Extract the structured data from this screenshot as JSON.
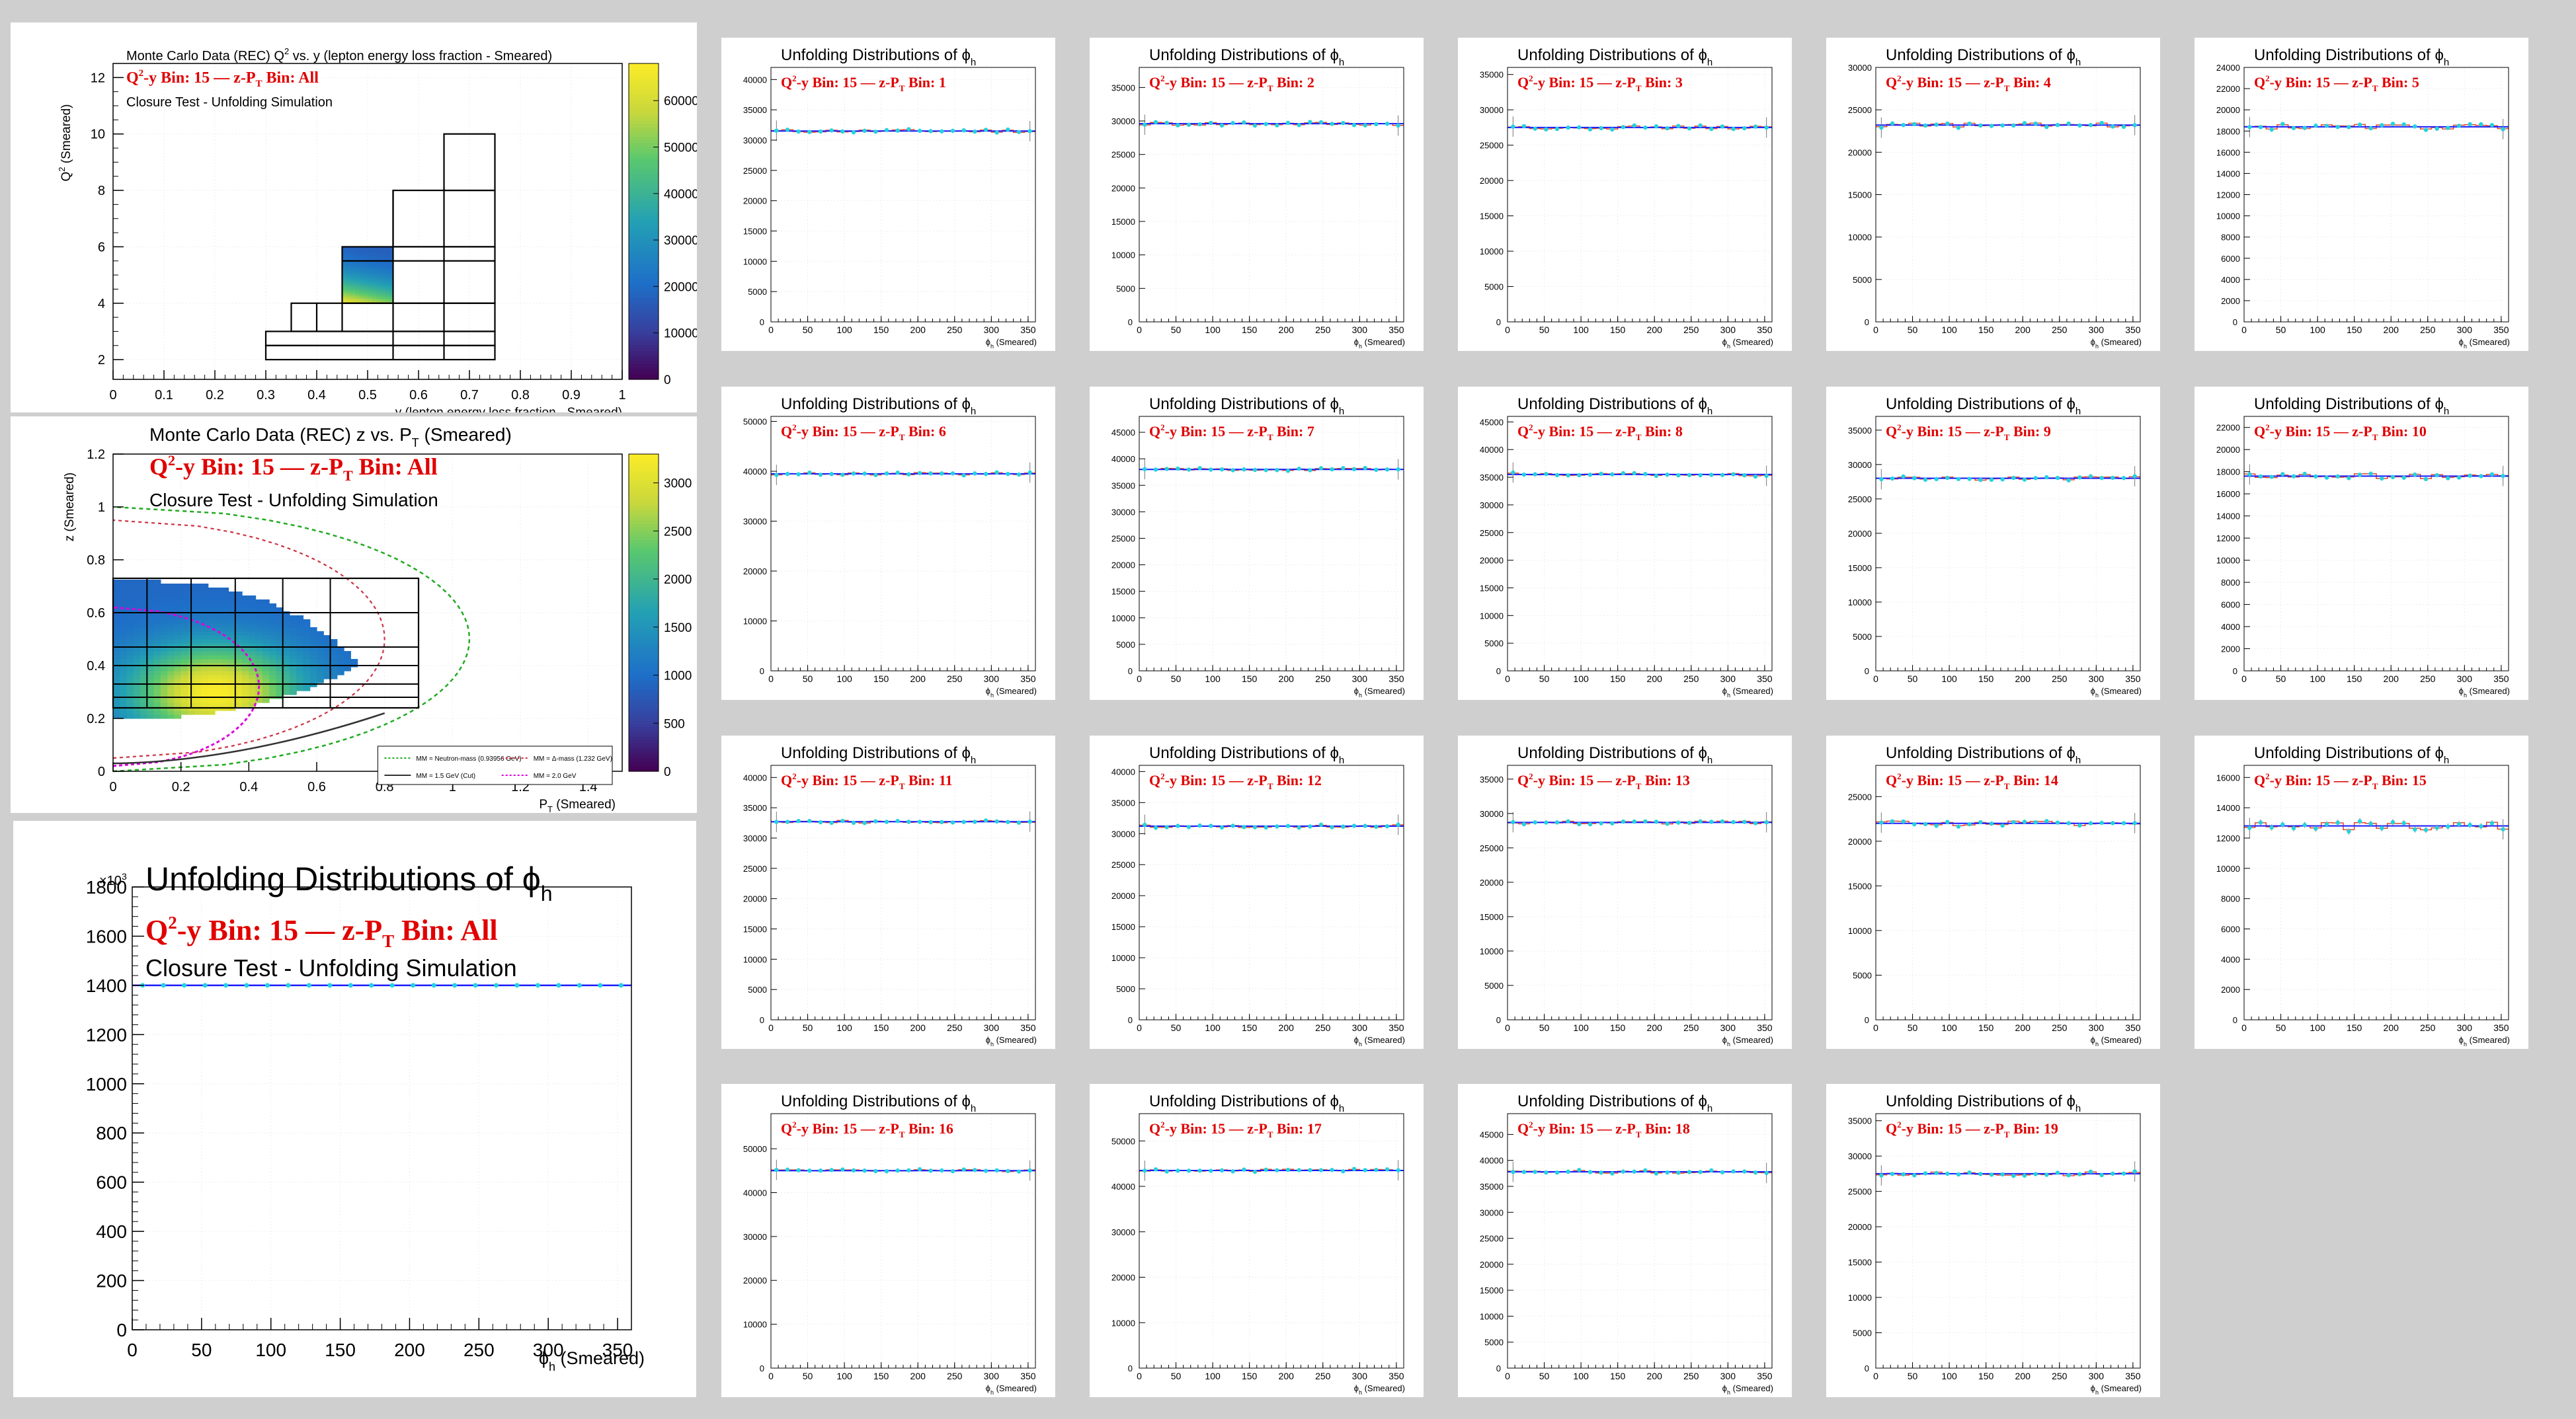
{
  "colors": {
    "background": "#cfcfcf",
    "panel": "#ffffff",
    "red_text": "#e00000",
    "fit_line": "#1a1aff",
    "hist_line": "#e04a2a",
    "points": "#22d3e0",
    "grid": "#eeeeee"
  },
  "palette_name": "viridis-like (blue to yellow)",
  "main_title": "Unfolding Distributions of",
  "phi_symbol": "ϕ",
  "phi_subscript": "h",
  "q2y_label": "Q",
  "q2y_sup": "2",
  "q2y_rest": "-y Bin: 15",
  "dash": "—",
  "zpt_label": "z-P",
  "zpt_sub": "T",
  "zpt_all": " Bin: All",
  "closure": "Closure Test - Unfolding Simulation",
  "chart_data": [
    {
      "id": "q2y",
      "type": "heatmap",
      "title": "Monte Carlo Data (REC) Q  vs. y (lepton energy loss fraction - Smeared)",
      "title_sup": "2",
      "xlabel": "y (lepton energy loss fraction - Smeared)",
      "ylabel": "Q  (Smeared)",
      "ylabel_sup": "2",
      "xlim": [
        0,
        1
      ],
      "ylim": [
        1.3,
        12.5
      ],
      "xticks": [
        "0",
        "0.1",
        "0.2",
        "0.3",
        "0.4",
        "0.5",
        "0.6",
        "0.7",
        "0.8",
        "0.9",
        "1"
      ],
      "yticks": [
        "2",
        "4",
        "6",
        "8",
        "10",
        "12"
      ],
      "zticks": [
        "0",
        "10000",
        "20000",
        "30000",
        "40000",
        "50000",
        "60000"
      ],
      "zlim": [
        0,
        68000
      ],
      "filled_region": {
        "x": [
          0.45,
          0.55
        ],
        "y": [
          4.0,
          6.0
        ]
      },
      "bin_grid": [
        [
          0.3,
          2.0,
          0.75,
          2.5
        ],
        [
          0.3,
          2.5,
          0.75,
          3.0
        ],
        [
          0.35,
          3.0,
          0.75,
          4.0
        ],
        [
          0.45,
          4.0,
          0.75,
          6.0
        ],
        [
          0.55,
          6.0,
          0.75,
          8.0
        ],
        [
          0.65,
          8.0,
          0.75,
          10.0
        ]
      ],
      "bin_lines": [
        [
          0.4,
          3.0,
          0.4,
          4.0
        ],
        [
          0.45,
          3.0,
          0.45,
          4.0
        ],
        [
          0.55,
          2.0,
          0.55,
          8.0
        ],
        [
          0.65,
          2.0,
          0.65,
          8.0
        ],
        [
          0.45,
          5.5,
          0.75,
          5.5
        ],
        [
          0.45,
          4.0,
          0.55,
          4.0
        ]
      ]
    },
    {
      "id": "zpt",
      "type": "heatmap",
      "title": "Monte Carlo Data (REC) z vs. P",
      "title_sub": "T",
      "title_end": " (Smeared)",
      "xlabel": "P",
      "xlabel_sub": "T",
      "xlabel_end": " (Smeared)",
      "ylabel": "z (Smeared)",
      "xlim": [
        0,
        1.5
      ],
      "ylim": [
        0,
        1.2
      ],
      "xticks": [
        "0",
        "0.2",
        "0.4",
        "0.6",
        "0.8",
        "1",
        "1.2",
        "1.4"
      ],
      "yticks": [
        "0",
        "0.2",
        "0.4",
        "0.6",
        "0.8",
        "1",
        "1.2"
      ],
      "zticks": [
        "0",
        "500",
        "1000",
        "1500",
        "2000",
        "2500",
        "3000"
      ],
      "zlim": [
        0,
        3300
      ],
      "bin_rect": [
        0,
        0.24,
        0.9,
        0.73
      ],
      "bin_x_edges": [
        0.1,
        0.23,
        0.36,
        0.5,
        0.64,
        0.9
      ],
      "bin_y_edges": [
        0.28,
        0.33,
        0.4,
        0.47,
        0.6
      ],
      "legend": [
        {
          "label": "MM = Neutron-mass (0.93956 GeV)",
          "color": "#22aa22",
          "dash": "3,3"
        },
        {
          "label": "MM = Δ-mass (1.232 GeV)",
          "color": "#cc3344",
          "dash": "3,3"
        },
        {
          "label": "MM = 1.5 GeV (Cut)",
          "color": "#333333",
          "dash": ""
        },
        {
          "label": "MM = 2.0 GeV",
          "color": "#dd00dd",
          "dash": "3,3"
        }
      ]
    },
    {
      "id": "big_all",
      "type": "line",
      "xlabel": "ϕ",
      "xlabel_sub": "h",
      "xlabel_end": " (Smeared)",
      "exponent": "×10",
      "exponent_sup": "3",
      "xlim": [
        0,
        360
      ],
      "ylim": [
        0,
        1800
      ],
      "xticks": [
        "0",
        "50",
        "100",
        "150",
        "200",
        "250",
        "300",
        "350"
      ],
      "yticks": [
        "0",
        "200",
        "400",
        "600",
        "800",
        "1000",
        "1200",
        "1400",
        "1600",
        "1800"
      ],
      "level": 1400
    }
  ],
  "small_panels": {
    "xlabel": "ϕ",
    "xlabel_sub": "h",
    "xlabel_end": " (Smeared)",
    "xticks": [
      "0",
      "50",
      "100",
      "150",
      "200",
      "250",
      "300",
      "350"
    ],
    "items": [
      {
        "bin": "1",
        "level": 31500,
        "ylim": [
          0,
          42000
        ],
        "yticks": [
          "5000",
          "10000",
          "15000",
          "20000",
          "25000",
          "30000",
          "35000",
          "40000"
        ],
        "noise": 0.008
      },
      {
        "bin": "2",
        "level": 29600,
        "ylim": [
          0,
          38000
        ],
        "yticks": [
          "5000",
          "10000",
          "15000",
          "20000",
          "25000",
          "30000",
          "35000"
        ],
        "noise": 0.009
      },
      {
        "bin": "3",
        "level": 27500,
        "ylim": [
          0,
          36000
        ],
        "yticks": [
          "5000",
          "10000",
          "15000",
          "20000",
          "25000",
          "30000",
          "35000"
        ],
        "noise": 0.008
      },
      {
        "bin": "4",
        "level": 23200,
        "ylim": [
          0,
          30000
        ],
        "yticks": [
          "5000",
          "10000",
          "15000",
          "20000",
          "25000",
          "30000"
        ],
        "noise": 0.01
      },
      {
        "bin": "5",
        "level": 18400,
        "ylim": [
          0,
          24000
        ],
        "yticks": [
          "2000",
          "4000",
          "6000",
          "8000",
          "10000",
          "12000",
          "14000",
          "16000",
          "18000",
          "20000",
          "22000",
          "24000"
        ],
        "noise": 0.012
      },
      {
        "bin": "6",
        "level": 39500,
        "ylim": [
          0,
          51000
        ],
        "yticks": [
          "10000",
          "20000",
          "30000",
          "40000",
          "50000"
        ],
        "noise": 0.006
      },
      {
        "bin": "7",
        "level": 38000,
        "ylim": [
          0,
          48000
        ],
        "yticks": [
          "5000",
          "10000",
          "15000",
          "20000",
          "25000",
          "30000",
          "35000",
          "40000",
          "45000"
        ],
        "noise": 0.006
      },
      {
        "bin": "8",
        "level": 35500,
        "ylim": [
          0,
          46000
        ],
        "yticks": [
          "5000",
          "10000",
          "15000",
          "20000",
          "25000",
          "30000",
          "35000",
          "40000",
          "45000"
        ],
        "noise": 0.007
      },
      {
        "bin": "9",
        "level": 28000,
        "ylim": [
          0,
          37000
        ],
        "yticks": [
          "5000",
          "10000",
          "15000",
          "20000",
          "25000",
          "30000",
          "35000"
        ],
        "noise": 0.01
      },
      {
        "bin": "10",
        "level": 17600,
        "ylim": [
          0,
          23000
        ],
        "yticks": [
          "2000",
          "4000",
          "6000",
          "8000",
          "10000",
          "12000",
          "14000",
          "16000",
          "18000",
          "20000",
          "22000"
        ],
        "noise": 0.013
      },
      {
        "bin": "11",
        "level": 32700,
        "ylim": [
          0,
          42000
        ],
        "yticks": [
          "5000",
          "10000",
          "15000",
          "20000",
          "25000",
          "30000",
          "35000",
          "40000"
        ],
        "noise": 0.007
      },
      {
        "bin": "12",
        "level": 31200,
        "ylim": [
          0,
          41000
        ],
        "yticks": [
          "5000",
          "10000",
          "15000",
          "20000",
          "25000",
          "30000",
          "35000",
          "40000"
        ],
        "noise": 0.007
      },
      {
        "bin": "13",
        "level": 28700,
        "ylim": [
          0,
          37000
        ],
        "yticks": [
          "5000",
          "10000",
          "15000",
          "20000",
          "25000",
          "30000",
          "35000"
        ],
        "noise": 0.008
      },
      {
        "bin": "14",
        "level": 22000,
        "ylim": [
          0,
          28500
        ],
        "yticks": [
          "5000",
          "10000",
          "15000",
          "20000",
          "25000"
        ],
        "noise": 0.012
      },
      {
        "bin": "15",
        "level": 12800,
        "ylim": [
          0,
          16800
        ],
        "yticks": [
          "2000",
          "4000",
          "6000",
          "8000",
          "10000",
          "12000",
          "14000",
          "16000"
        ],
        "noise": 0.02
      },
      {
        "bin": "16",
        "level": 45000,
        "ylim": [
          0,
          58000
        ],
        "yticks": [
          "10000",
          "20000",
          "30000",
          "40000",
          "50000"
        ],
        "noise": 0.006
      },
      {
        "bin": "17",
        "level": 43500,
        "ylim": [
          0,
          56000
        ],
        "yticks": [
          "10000",
          "20000",
          "30000",
          "40000",
          "50000"
        ],
        "noise": 0.006
      },
      {
        "bin": "18",
        "level": 37800,
        "ylim": [
          0,
          49000
        ],
        "yticks": [
          "5000",
          "10000",
          "15000",
          "20000",
          "25000",
          "30000",
          "35000",
          "40000",
          "45000"
        ],
        "noise": 0.007
      },
      {
        "bin": "19",
        "level": 27500,
        "ylim": [
          0,
          36000
        ],
        "yticks": [
          "5000",
          "10000",
          "15000",
          "20000",
          "25000",
          "30000",
          "35000"
        ],
        "noise": 0.01
      }
    ]
  }
}
